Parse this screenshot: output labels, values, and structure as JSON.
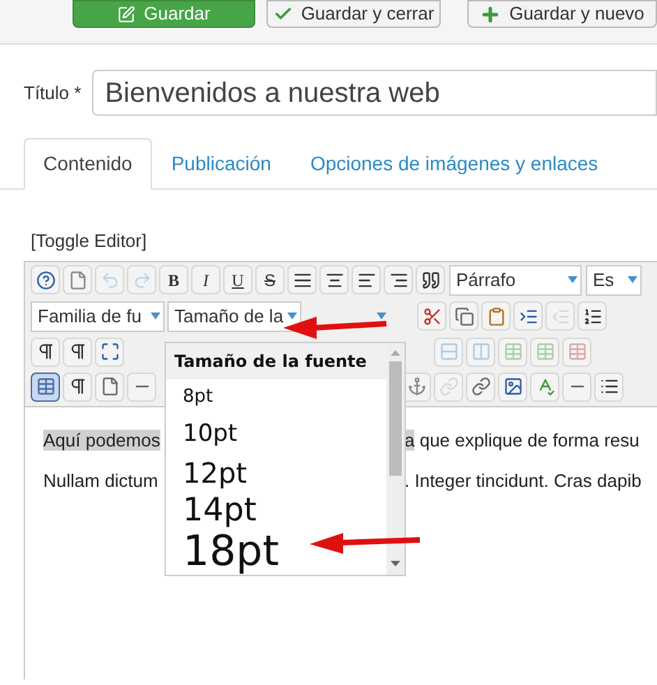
{
  "action_buttons": [
    {
      "label": "Guardar",
      "kind": "primary"
    },
    {
      "label": "Guardar y cerrar",
      "kind": "check"
    },
    {
      "label": "Guardar y nuevo",
      "kind": "new"
    }
  ],
  "title_field": {
    "label": "Título *",
    "value": "Bienvenidos a nuestra web"
  },
  "tabs": [
    {
      "label": "Contenido",
      "selected": true
    },
    {
      "label": "Publicación",
      "selected": false
    },
    {
      "label": "Opciones de imágenes y enlaces",
      "selected": false
    }
  ],
  "toggle_editor": "[Toggle Editor]",
  "editor": {
    "format_buttons": [
      "B",
      "I",
      "U",
      "S"
    ],
    "block_format": "Párrafo",
    "styles_select": "Es",
    "font_family": "Familia de fu",
    "font_size": "Tamaño de la",
    "font_size_menu": {
      "title": "Tamaño de la fuente",
      "options": [
        "8pt",
        "10pt",
        "12pt",
        "14pt",
        "18pt"
      ]
    },
    "paragraphs": [
      [
        {
          "text": "Aquí podemos",
          "selected": true
        },
        {
          "text": "a",
          "selected": true
        },
        {
          "text": " que explique de forma resu",
          "selected": false
        }
      ],
      [
        {
          "text": "Nullam dictum",
          "selected": false
        },
        {
          "text": ". Integer tincidunt. Cras dapib",
          "selected": false
        }
      ]
    ]
  }
}
